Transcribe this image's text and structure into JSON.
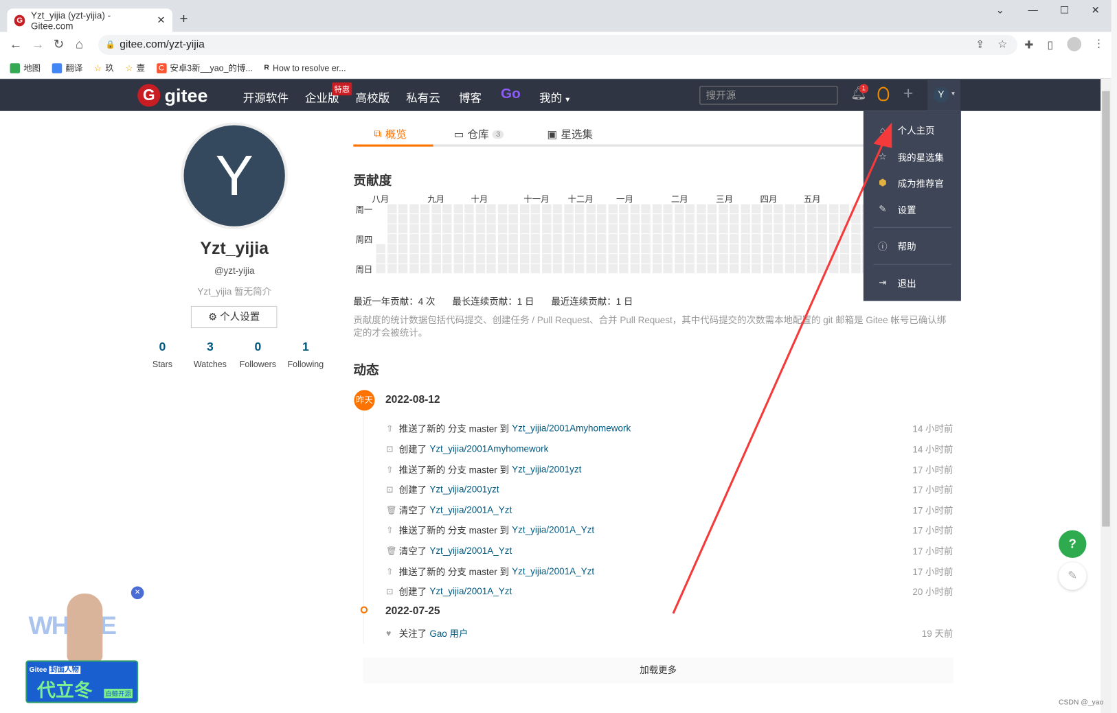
{
  "browser": {
    "tab_title": "Yzt_yijia (yzt-yijia) - Gitee.com",
    "url": "gitee.com/yzt-yijia",
    "bookmarks": [
      "地图",
      "翻译",
      "玖",
      "壹",
      "安卓3新__yao_的博...",
      "How to resolve er..."
    ]
  },
  "nav": {
    "logo": "gitee",
    "items": [
      "开源软件",
      "企业版",
      "高校版",
      "私有云",
      "博客",
      "Go",
      "我的"
    ],
    "hot_badge": "特惠",
    "search_placeholder": "搜开源",
    "notification_count": "1",
    "avatar_letter": "Y"
  },
  "dropdown": {
    "items": [
      "个人主页",
      "我的星选集",
      "成为推荐官",
      "设置",
      "帮助",
      "退出"
    ]
  },
  "profile": {
    "avatar_letter": "Y",
    "name": "Yzt_yijia",
    "handle": "@yzt-yijia",
    "bio": "Yzt_yijia 暂无简介",
    "settings_button": "个人设置",
    "stats": [
      {
        "n": "0",
        "l": "Stars"
      },
      {
        "n": "3",
        "l": "Watches"
      },
      {
        "n": "0",
        "l": "Followers"
      },
      {
        "n": "1",
        "l": "Following"
      }
    ]
  },
  "tabs": [
    {
      "label": "概览",
      "active": true
    },
    {
      "label": "仓库",
      "count": "3"
    },
    {
      "label": "星选集"
    }
  ],
  "contrib": {
    "title": "贡献度",
    "months": [
      "八月",
      "九月",
      "十月",
      "十一月",
      "十二月",
      "一月",
      "二月",
      "三月",
      "四月",
      "五月"
    ],
    "days": [
      "周一",
      "周四",
      "周日"
    ],
    "stats": [
      "最近一年贡献：4 次",
      "最长连续贡献：1 日",
      "最近连续贡献：1 日"
    ],
    "note": "贡献度的统计数据包括代码提交、创建任务 / Pull Request、合并 Pull Request，其中代码提交的次数需本地配置的 git 邮箱是 Gitee 帐号已确认绑定的才会被统计。"
  },
  "activity": {
    "title": "动态",
    "yesterday": "昨天",
    "groups": [
      {
        "date": "2022-08-12",
        "items": [
          {
            "icon": "push",
            "text": "推送了新的 分支 master 到 ",
            "link": "Yzt_yijia/2001Amyhomework",
            "age": "14 小时前"
          },
          {
            "icon": "create",
            "text": "创建了 ",
            "link": "Yzt_yijia/2001Amyhomework",
            "age": "14 小时前"
          },
          {
            "icon": "push",
            "text": "推送了新的 分支 master 到 ",
            "link": "Yzt_yijia/2001yzt",
            "age": "17 小时前"
          },
          {
            "icon": "create",
            "text": "创建了 ",
            "link": "Yzt_yijia/2001yzt",
            "age": "17 小时前"
          },
          {
            "icon": "trash",
            "text": "清空了 ",
            "link": "Yzt_yijia/2001A_Yzt",
            "age": "17 小时前"
          },
          {
            "icon": "push",
            "text": "推送了新的 分支 master 到 ",
            "link": "Yzt_yijia/2001A_Yzt",
            "age": "17 小时前"
          },
          {
            "icon": "trash",
            "text": "清空了 ",
            "link": "Yzt_yijia/2001A_Yzt",
            "age": "17 小时前"
          },
          {
            "icon": "push",
            "text": "推送了新的 分支 master 到 ",
            "link": "Yzt_yijia/2001A_Yzt",
            "age": "17 小时前"
          },
          {
            "icon": "create",
            "text": "创建了 ",
            "link": "Yzt_yijia/2001A_Yzt",
            "age": "20 小时前"
          }
        ]
      },
      {
        "date": "2022-07-25",
        "items": [
          {
            "icon": "heart",
            "text": "关注了 ",
            "link": "Gao 用户",
            "age": "19 天前"
          }
        ]
      }
    ],
    "load_more": "加载更多"
  },
  "ad": {
    "brand": "Gitee",
    "tag": "封面人物",
    "headline": "代立冬",
    "sub": "白鲸开源",
    "bg_text": "WHALE"
  },
  "watermark": "CSDN @_yao",
  "colors": {
    "nav_bg": "#2f3542",
    "accent": "#fe7300",
    "link": "#005980",
    "annotation_arrow": "#f43a3a"
  }
}
